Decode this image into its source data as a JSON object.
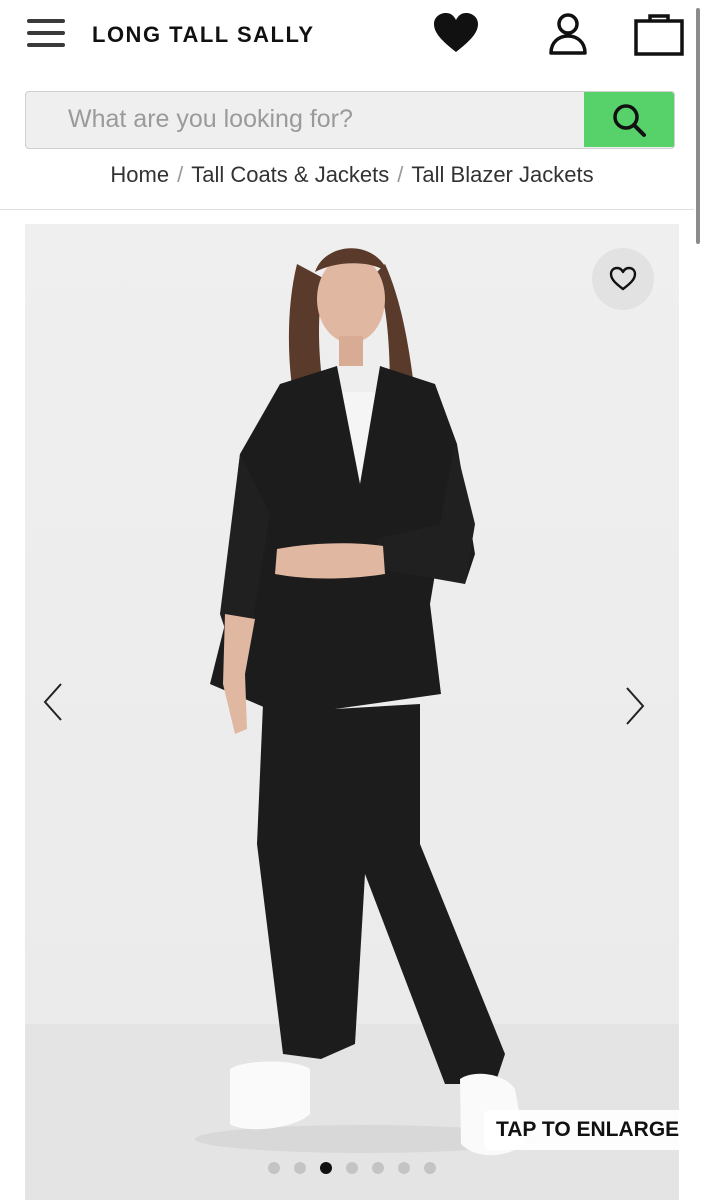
{
  "header": {
    "brand": "LONG TALL SALLY",
    "icons": [
      "menu-icon",
      "heart-icon",
      "account-icon",
      "bag-icon"
    ]
  },
  "search": {
    "placeholder": "What are you looking for?",
    "value": "",
    "button_icon": "search-icon",
    "button_color": "#57d26a"
  },
  "breadcrumb": [
    {
      "label": "Home"
    },
    {
      "label": "Tall Coats & Jackets"
    },
    {
      "label": "Tall Blazer Jackets"
    }
  ],
  "gallery": {
    "tap_to_enlarge": "TAP TO ENLARGE",
    "image_count": 7,
    "active_index": 2,
    "icons": [
      "favourite-heart-icon",
      "chevron-left-icon",
      "chevron-right-icon"
    ]
  },
  "colors": {
    "accent_green": "#57d26a",
    "text": "#222222",
    "garment": "#1c1c1c"
  }
}
